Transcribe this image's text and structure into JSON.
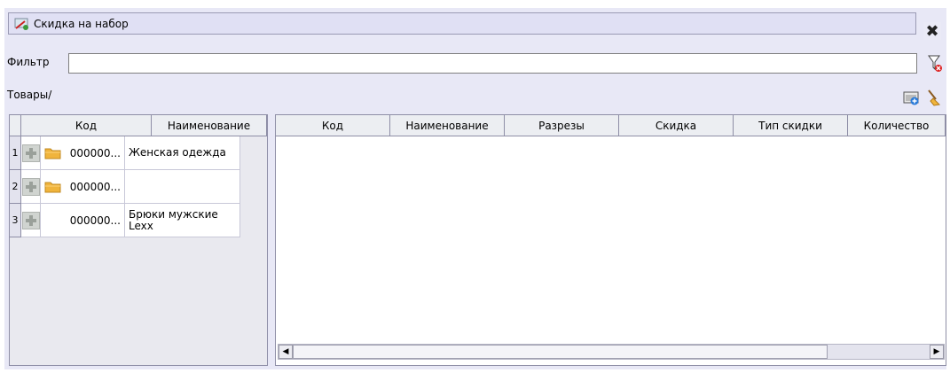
{
  "window": {
    "title": "Скидка на набор",
    "icon": "discount-tag-icon"
  },
  "filter": {
    "label": "Фильтр",
    "value": ""
  },
  "goods": {
    "label": "Товары/"
  },
  "left_grid": {
    "columns": [
      "Код",
      "Наименование"
    ],
    "rows": [
      {
        "num": "1",
        "has_folder": true,
        "code": "000000...",
        "name": "Женская одежда"
      },
      {
        "num": "2",
        "has_folder": true,
        "code": "000000...",
        "name": ""
      },
      {
        "num": "3",
        "has_folder": false,
        "code": "000000...",
        "name": "Брюки мужские Lexx"
      }
    ]
  },
  "right_grid": {
    "columns": [
      "Код",
      "Наименование",
      "Разрезы",
      "Скидка",
      "Тип скидки",
      "Количество"
    ]
  },
  "colors": {
    "panel_bg": "#e8e8f6",
    "folder": "#f0b43c"
  }
}
